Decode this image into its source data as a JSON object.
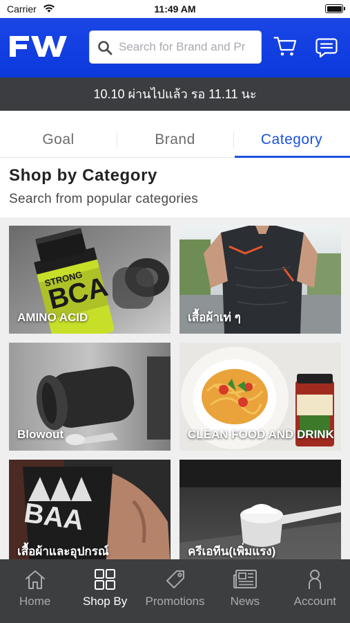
{
  "status_bar": {
    "carrier": "Carrier",
    "time": "11:49 AM",
    "wifi_icon": "wifi-icon",
    "battery_icon": "battery-icon"
  },
  "header": {
    "logo_text": "FW",
    "search": {
      "placeholder": "Search for Brand and Pr",
      "value": "",
      "icon": "search-icon"
    },
    "cart_icon": "cart-icon",
    "chat_icon": "chat-icon",
    "colors": {
      "brand": "#0b39dc"
    }
  },
  "announcement": "10.10 ผ่านไปแล้ว รอ 11.11 นะ",
  "tabs": [
    {
      "label": "Goal",
      "active": false
    },
    {
      "label": "Brand",
      "active": false
    },
    {
      "label": "Category",
      "active": true
    }
  ],
  "section": {
    "title": "Shop by Category",
    "subtitle": "Search from popular categories"
  },
  "categories": [
    {
      "label": "AMINO ACID"
    },
    {
      "label": "เสื้อผ้าเท่ ๆ"
    },
    {
      "label": "Blowout"
    },
    {
      "label": "CLEAN FOOD AND DRINK"
    },
    {
      "label": "เสื้อผ้าและอุปกรณ์"
    },
    {
      "label": "ครีเอทีน(เพิ่มแรง)"
    }
  ],
  "tabbar": [
    {
      "label": "Home",
      "icon": "home-icon",
      "active": false
    },
    {
      "label": "Shop By",
      "icon": "grid-icon",
      "active": true
    },
    {
      "label": "Promotions",
      "icon": "tag-icon",
      "active": false
    },
    {
      "label": "News",
      "icon": "newspaper-icon",
      "active": false
    },
    {
      "label": "Account",
      "icon": "person-icon",
      "active": false
    }
  ]
}
